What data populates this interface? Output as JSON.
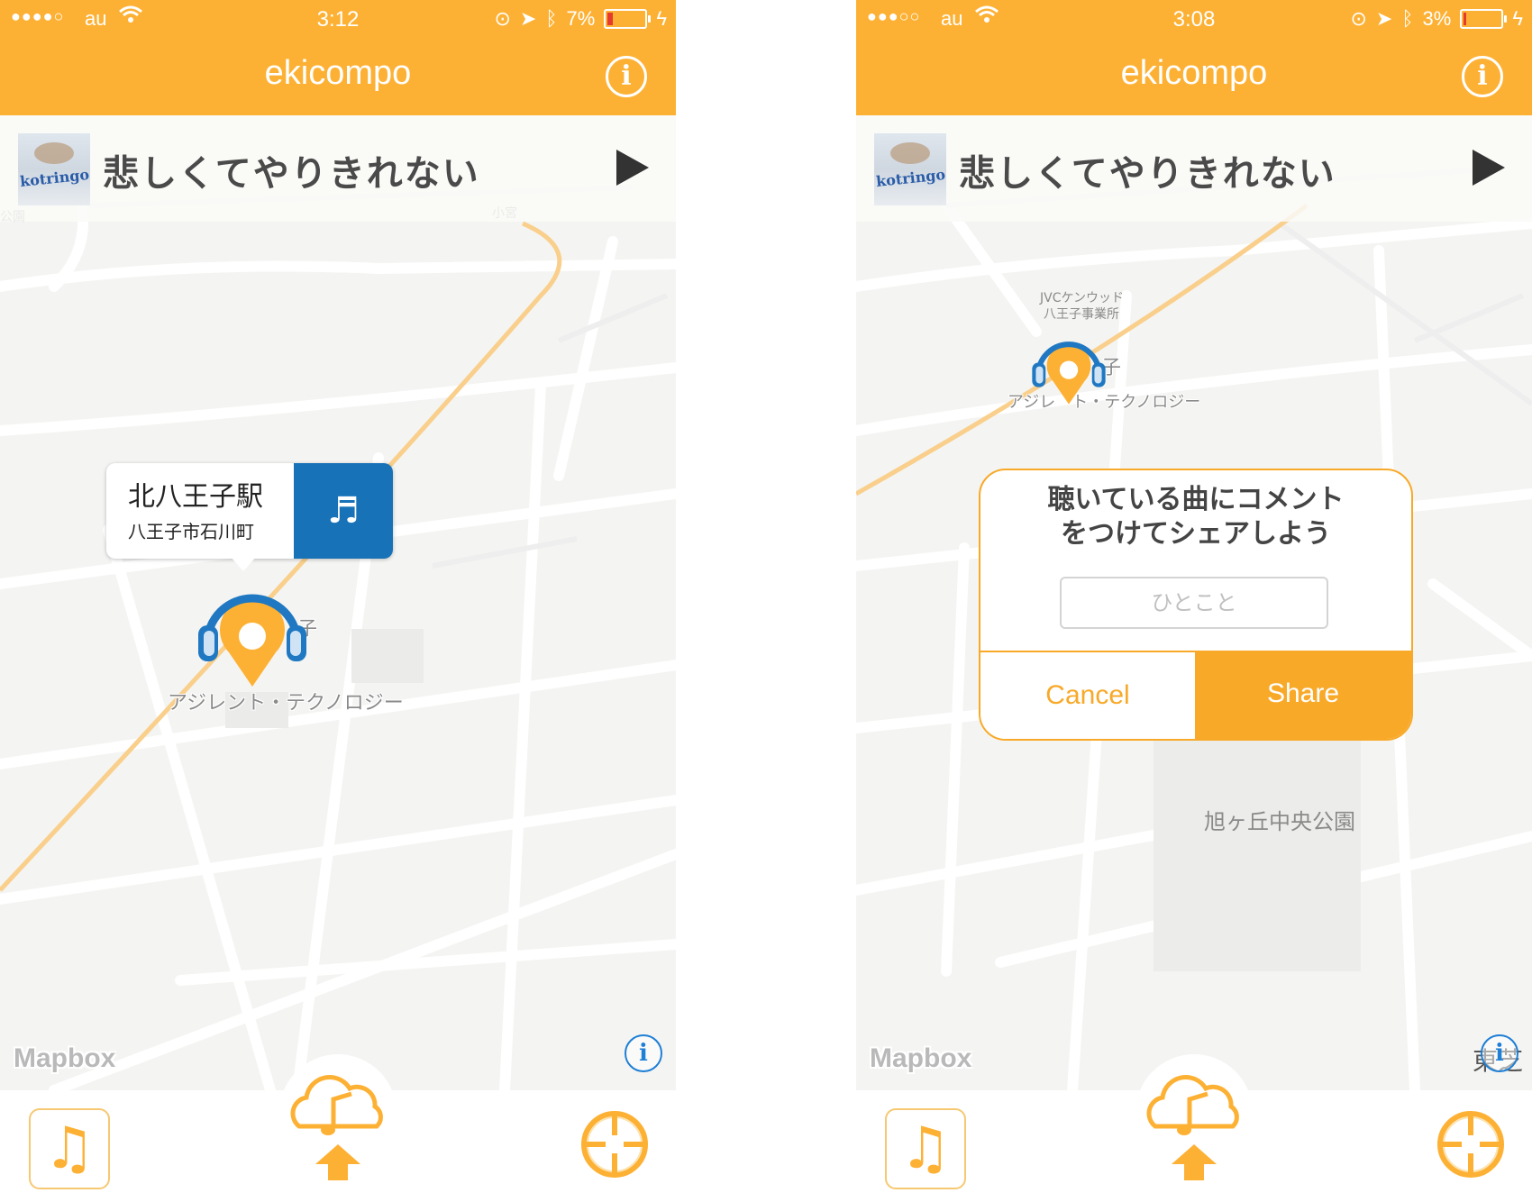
{
  "screens": [
    {
      "status": {
        "signal": "●●●●○",
        "carrier": "au",
        "time": "3:12",
        "battery": "7%"
      },
      "nav": {
        "title": "ekicompo"
      },
      "now_playing": {
        "title": "悲しくてやりきれない",
        "album_text": "kotringo"
      },
      "map": {
        "labels": [
          "公園",
          "小宮"
        ],
        "attribution": "Mapbox"
      },
      "callout": {
        "station": "北八王子駅",
        "address": "八王子市石川町"
      },
      "pin_label": "アジレント・テクノロジー",
      "pin_partial_char": "子"
    },
    {
      "status": {
        "signal": "●●●○○",
        "carrier": "au",
        "time": "3:08",
        "battery": "3%"
      },
      "nav": {
        "title": "ekicompo"
      },
      "now_playing": {
        "title": "悲しくてやりきれない",
        "album_text": "kotringo"
      },
      "map": {
        "labels": [
          "JVCケンウッド",
          "八王子事業所",
          "旭ヶ丘中央公園",
          "東芝"
        ],
        "attribution": "Mapbox"
      },
      "pin_label": "アジレ　ト・テクノロジー",
      "pin_partial_char": "子",
      "dialog": {
        "message_line1": "聴いている曲にコメント",
        "message_line2": "をつけてシェアしよう",
        "input_placeholder": "ひとこと",
        "cancel_label": "Cancel",
        "share_label": "Share"
      }
    }
  ],
  "colors": {
    "accent": "#fdb134",
    "callout_action": "#1772b8",
    "pin_blue": "#1f78c1",
    "dialog_orange": "#f8a928"
  },
  "icons": [
    "wifi-icon",
    "info-icon",
    "play-icon",
    "music-note-icon",
    "cloud-upload-icon",
    "locate-crosshair-icon",
    "headphone-pin-icon"
  ]
}
